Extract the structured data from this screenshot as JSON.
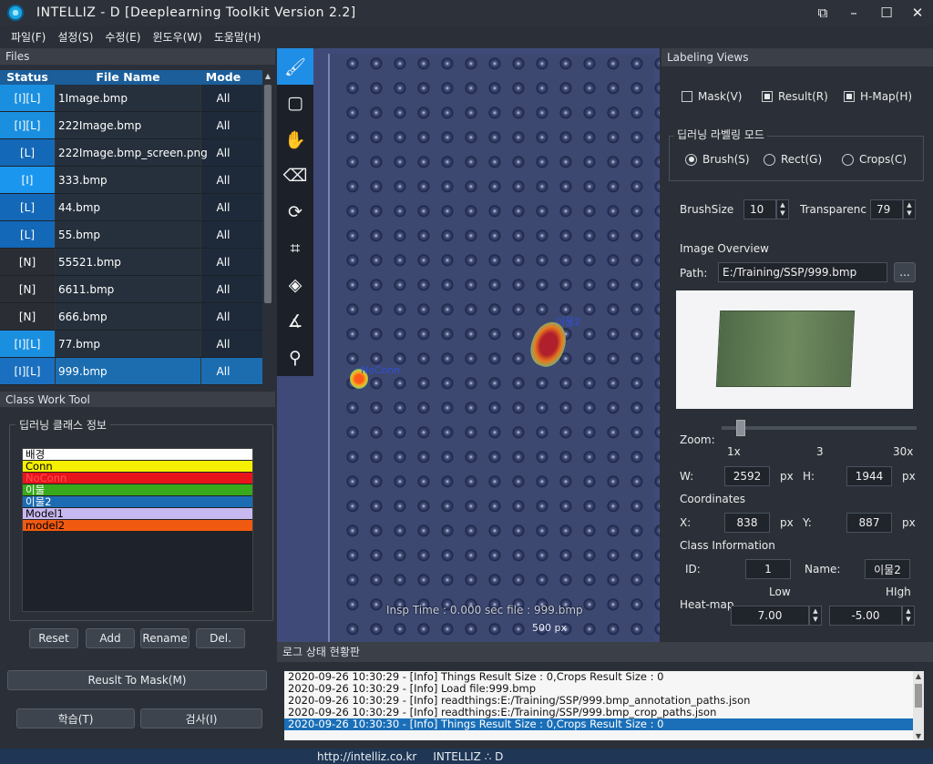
{
  "window": {
    "title": "INTELLIZ - D [Deeplearning Toolkit Version 2.2]",
    "restore_glyph": "⧉",
    "minimize_glyph": "–",
    "maximize_glyph": "☐",
    "close_glyph": "✕"
  },
  "menu": [
    "파일(F)",
    "설정(S)",
    "수정(E)",
    "윈도우(W)",
    "도움말(H)"
  ],
  "files": {
    "panel_title": "Files",
    "columns": [
      "Status",
      "File Name",
      "Mode"
    ],
    "rows": [
      {
        "status": "[I][L]",
        "name": "1Image.bmp",
        "mode": "All",
        "color": "#1a8fe0"
      },
      {
        "status": "[I][L]",
        "name": "222Image.bmp",
        "mode": "All",
        "color": "#1a8fe0"
      },
      {
        "status": "[L]",
        "name": "222Image.bmp_screen.png",
        "mode": "All",
        "color": "#1468b8"
      },
      {
        "status": "[I]",
        "name": "333.bmp",
        "mode": "All",
        "color": "#1a96ee"
      },
      {
        "status": "[L]",
        "name": "44.bmp",
        "mode": "All",
        "color": "#1468b8"
      },
      {
        "status": "[L]",
        "name": "55.bmp",
        "mode": "All",
        "color": "#1468b8"
      },
      {
        "status": "[N]",
        "name": "55521.bmp",
        "mode": "All",
        "color": "#2a2e34"
      },
      {
        "status": "[N]",
        "name": "6611.bmp",
        "mode": "All",
        "color": "#2a2e34"
      },
      {
        "status": "[N]",
        "name": "666.bmp",
        "mode": "All",
        "color": "#2a2e34"
      },
      {
        "status": "[I][L]",
        "name": "77.bmp",
        "mode": "All",
        "color": "#1a8fe0"
      },
      {
        "status": "[I][L]",
        "name": "999.bmp",
        "mode": "All",
        "color": "#1a6fc0",
        "selected": true
      }
    ]
  },
  "class_tool": {
    "panel_title": "Class Work Tool",
    "group_title": "딥러닝 클래스 정보",
    "classes": [
      {
        "name": "배경",
        "bg": "#ffffff",
        "fg": "#000000"
      },
      {
        "name": "Conn",
        "bg": "#f6f000",
        "fg": "#000000"
      },
      {
        "name": "NoConn",
        "bg": "#e8141c",
        "fg": "#ff5050"
      },
      {
        "name": "이물",
        "bg": "#38a81c",
        "fg": "#ffffff"
      },
      {
        "name": "이물2",
        "bg": "#1c6cb4",
        "fg": "#ffffff"
      },
      {
        "name": "Model1",
        "bg": "#c8b8f0",
        "fg": "#000000"
      },
      {
        "name": "model2",
        "bg": "#f05a10",
        "fg": "#000000"
      }
    ],
    "buttons": {
      "reset": "Reset",
      "add": "Add",
      "rename": "Rename",
      "delete": "Del."
    },
    "result_to_mask": "Reuslt To Mask(M)",
    "train": "학습(T)",
    "inspect": "검사(I)"
  },
  "tools": [
    {
      "name": "brush-tool",
      "glyph": "🖌",
      "active": true
    },
    {
      "name": "rect-tool",
      "glyph": "▢"
    },
    {
      "name": "pan-tool",
      "glyph": "✋"
    },
    {
      "name": "eraser-tool",
      "glyph": "⌫"
    },
    {
      "name": "rotate-tool",
      "glyph": "⟳"
    },
    {
      "name": "crop-tool",
      "glyph": "⌗"
    },
    {
      "name": "fill-tool",
      "glyph": "◈"
    },
    {
      "name": "angle-tool",
      "glyph": "∡"
    },
    {
      "name": "search-tool",
      "glyph": "⚲"
    }
  ],
  "canvas": {
    "label_noconn": "NoConn",
    "label_foreign": "이물2",
    "overlay": "Insp Time : 0.000 sec file : 999.bmp",
    "scale": "500 px"
  },
  "log": {
    "panel_title": "로그 상태 현황판",
    "lines": [
      "2020-09-26 10:30:29 - [Info] Things Result Size : 0,Crops Result Size : 0",
      "2020-09-26 10:30:29 - [Info] Load file:999.bmp",
      "2020-09-26 10:30:29 - [Info] readthings:E:/Training/SSP/999.bmp_annotation_paths.json",
      "2020-09-26 10:30:29 - [Info] readthings:E:/Training/SSP/999.bmp_crop_paths.json",
      "2020-09-26 10:30:30 - [Info] Things Result Size : 0,Crops Result Size : 0"
    ]
  },
  "labeling": {
    "panel_title": "Labeling Views",
    "mask": "Mask(V)",
    "result": "Result(R)",
    "hmap": "H-Map(H)",
    "mode_title": "딥러닝 라벨링 모드",
    "brush": "Brush(S)",
    "rect": "Rect(G)",
    "crops": "Crops(C)",
    "brush_size_label": "BrushSize",
    "brush_size": "10",
    "transparency_label": "Transparenc",
    "transparency": "79",
    "overview_label": "Image Overview",
    "path_label": "Path:",
    "path": "E:/Training/SSP/999.bmp",
    "browse": "...",
    "zoom_label": "Zoom:",
    "zoom_ticks": [
      "1x",
      "3",
      "30x"
    ],
    "w_label": "W:",
    "w": "2592",
    "h_label": "H:",
    "h": "1944",
    "px": "px",
    "coords_label": "Coordinates",
    "x_label": "X:",
    "x": "838",
    "y_label": "Y:",
    "y": "887",
    "class_info_label": "Class Information",
    "id_label": "ID:",
    "id": "1",
    "name_label": "Name:",
    "name": "이물2",
    "heatmap_label": "Heat-map",
    "low_label": "Low",
    "high_label": "HIgh",
    "low": "7.00",
    "high": "-5.00"
  },
  "status": {
    "url": "http://intelliz.co.kr",
    "brand": "INTELLIZ ∴ D"
  }
}
